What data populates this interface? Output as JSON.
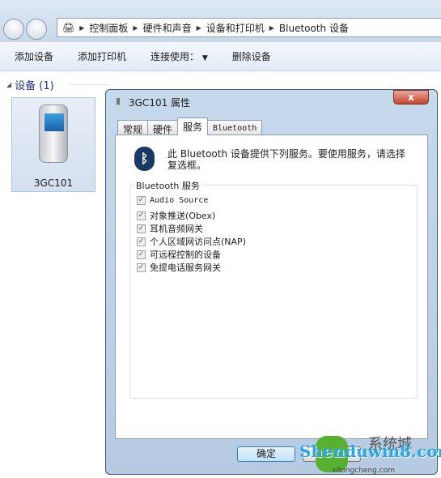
{
  "nav": {
    "breadcrumb": [
      "控制面板",
      "硬件和声音",
      "设备和打印机",
      "Bluetooth 设备"
    ]
  },
  "toolbar": {
    "add_device": "添加设备",
    "add_printer": "添加打印机",
    "connect_using": "连接使用：",
    "remove_device": "删除设备"
  },
  "section": {
    "title": "设备 (1)"
  },
  "device": {
    "name": "3GC101"
  },
  "dialog": {
    "title": "3GC101 属性",
    "close": "x",
    "tabs": [
      "常规",
      "硬件",
      "服务",
      "Bluetooth"
    ],
    "selected_tab": "服务",
    "description": "此 Bluetooth 设备提供下列服务。要使用服务，请选择复选框。",
    "group_label": "Bluetooth 服务",
    "services": [
      {
        "label": "Audio Source",
        "checked": true
      },
      {
        "label": "对象推送(Obex)",
        "checked": true
      },
      {
        "label": "耳机音频网关",
        "checked": true
      },
      {
        "label": "个人区域网访问点(NAP)",
        "checked": true
      },
      {
        "label": "可远程控制的设备",
        "checked": true
      },
      {
        "label": "免提电话服务网关",
        "checked": true
      }
    ],
    "ok": "确定"
  },
  "watermark": {
    "main": "Shenduwin8.com",
    "sub": "xitongcheng.com",
    "brand": "系统城"
  }
}
